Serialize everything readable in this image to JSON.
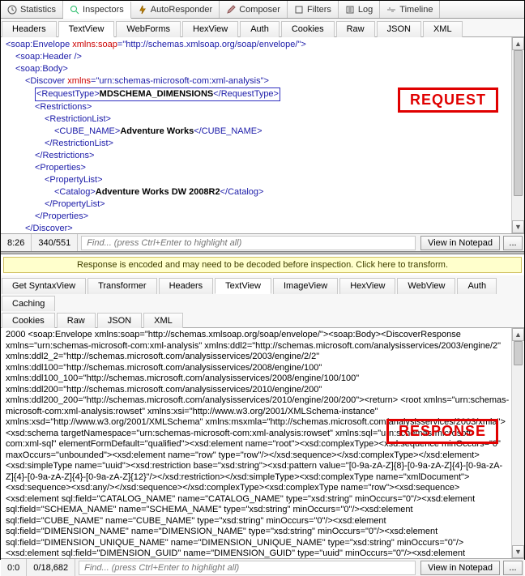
{
  "top_tabs": {
    "statistics": "Statistics",
    "inspectors": "Inspectors",
    "autoresponder": "AutoResponder",
    "composer": "Composer",
    "filters": "Filters",
    "log": "Log",
    "timeline": "Timeline"
  },
  "request": {
    "subtabs": {
      "headers": "Headers",
      "textview": "TextView",
      "webforms": "WebForms",
      "hexview": "HexView",
      "auth": "Auth",
      "cookies": "Cookies",
      "raw": "Raw",
      "json": "JSON",
      "xml": "XML"
    },
    "xml_lines": [
      {
        "indent": 0,
        "html": "&lt;soap:Envelope <span class='attr'>xmlns:soap</span>=\"http://schemas.xmlsoap.org/soap/envelope/\"&gt;"
      },
      {
        "indent": 1,
        "html": "&lt;soap:Header /&gt;"
      },
      {
        "indent": 1,
        "html": "&lt;soap:Body&gt;"
      },
      {
        "indent": 2,
        "html": "&lt;Discover <span class='attr'>xmlns</span>=\"urn:schemas-microsoft-com:xml-analysis\"&gt;"
      },
      {
        "indent": 3,
        "html": "&lt;RequestType&gt;<span class='text'>MDSCHEMA_DIMENSIONS</span>&lt;/RequestType&gt;",
        "highlight": true
      },
      {
        "indent": 3,
        "html": "&lt;Restrictions&gt;"
      },
      {
        "indent": 4,
        "html": "&lt;RestrictionList&gt;"
      },
      {
        "indent": 5,
        "html": "&lt;CUBE_NAME&gt;<span class='text'>Adventure Works</span>&lt;/CUBE_NAME&gt;"
      },
      {
        "indent": 4,
        "html": "&lt;/RestrictionList&gt;"
      },
      {
        "indent": 3,
        "html": "&lt;/Restrictions&gt;"
      },
      {
        "indent": 3,
        "html": "&lt;Properties&gt;"
      },
      {
        "indent": 4,
        "html": "&lt;PropertyList&gt;"
      },
      {
        "indent": 5,
        "html": "&lt;Catalog&gt;<span class='text'>Adventure Works DW 2008R2</span>&lt;/Catalog&gt;"
      },
      {
        "indent": 4,
        "html": "&lt;/PropertyList&gt;"
      },
      {
        "indent": 3,
        "html": "&lt;/Properties&gt;"
      },
      {
        "indent": 2,
        "html": "&lt;/Discover&gt;"
      }
    ],
    "overlay": "REQUEST",
    "status": {
      "pos": "8:26",
      "size": "340/551",
      "find_placeholder": "Find... (press Ctrl+Enter to highlight all)",
      "notepad": "View in Notepad",
      "more": "..."
    }
  },
  "banner": "Response is encoded and may need to be decoded before inspection. Click here to transform.",
  "response": {
    "subtabs_row1": {
      "get_syntaxview": "Get SyntaxView",
      "transformer": "Transformer",
      "headers": "Headers",
      "textview": "TextView",
      "imageview": "ImageView",
      "hexview": "HexView",
      "webview": "WebView",
      "auth": "Auth",
      "caching": "Caching"
    },
    "subtabs_row2": {
      "cookies": "Cookies",
      "raw": "Raw",
      "json": "JSON",
      "xml": "XML"
    },
    "overlay": "RESPONSE",
    "body": "2000\n<soap:Envelope xmlns:soap=\"http://schemas.xmlsoap.org/soap/envelope/\"><soap:Body><DiscoverResponse xmlns=\"urn:schemas-microsoft-com:xml-analysis\" xmlns:ddl2=\"http://schemas.microsoft.com/analysisservices/2003/engine/2\" xmlns:ddl2_2=\"http://schemas.microsoft.com/analysisservices/2003/engine/2/2\" xmlns:ddl100=\"http://schemas.microsoft.com/analysisservices/2008/engine/100\" xmlns:ddl100_100=\"http://schemas.microsoft.com/analysisservices/2008/engine/100/100\" xmlns:ddl200=\"http://schemas.microsoft.com/analysisservices/2010/engine/200\" xmlns:ddl200_200=\"http://schemas.microsoft.com/analysisservices/2010/engine/200/200\"><return>   <root xmlns=\"urn:schemas-microsoft-com:xml-analysis:rowset\" xmlns:xsi=\"http://www.w3.org/2001/XMLSchema-instance\" xmlns:xsd=\"http://www.w3.org/2001/XMLSchema\" xmlns:msxmla=\"http://schemas.microsoft.com/analysisservices/2003/xmla\"><xsd:schema targetNamespace=\"urn:schemas-microsoft-com:xml-analysis:rowset\" xmlns:sql=\"urn:schemas-microsoft-com:xml-sql\" elementFormDefault=\"qualified\"><xsd:element name=\"root\"><xsd:complexType><xsd:sequence minOccurs=\"0\" maxOccurs=\"unbounded\"><xsd:element name=\"row\" type=\"row\"/></xsd:sequence></xsd:complexType></xsd:element><xsd:simpleType name=\"uuid\"><xsd:restriction base=\"xsd:string\"><xsd:pattern value=\"[0-9a-zA-Z]{8}-[0-9a-zA-Z]{4}-[0-9a-zA-Z]{4}-[0-9a-zA-Z]{4}-[0-9a-zA-Z]{12}\"/></xsd:restriction></xsd:simpleType><xsd:complexType name=\"xmlDocument\"><xsd:sequence><xsd:any/></xsd:sequence></xsd:complexType><xsd:complexType name=\"row\"><xsd:sequence><xsd:element sql:field=\"CATALOG_NAME\" name=\"CATALOG_NAME\" type=\"xsd:string\" minOccurs=\"0\"/><xsd:element sql:field=\"SCHEMA_NAME\" name=\"SCHEMA_NAME\" type=\"xsd:string\" minOccurs=\"0\"/><xsd:element sql:field=\"CUBE_NAME\" name=\"CUBE_NAME\" type=\"xsd:string\" minOccurs=\"0\"/><xsd:element sql:field=\"DIMENSION_NAME\" name=\"DIMENSION_NAME\" type=\"xsd:string\" minOccurs=\"0\"/><xsd:element sql:field=\"DIMENSION_UNIQUE_NAME\" name=\"DIMENSION_UNIQUE_NAME\" type=\"xsd:string\" minOccurs=\"0\"/><xsd:element sql:field=\"DIMENSION_GUID\" name=\"DIMENSION_GUID\" type=\"uuid\" minOccurs=\"0\"/><xsd:element sql:field=\"DIMENSION_CAPTION\" name=\"DIMENSION_CAPTION\" type=\"xsd:string\"",
    "status": {
      "pos": "0:0",
      "size": "0/18,682",
      "find_placeholder": "Find... (press Ctrl+Enter to highlight all)",
      "notepad": "View in Notepad",
      "more": "..."
    }
  }
}
